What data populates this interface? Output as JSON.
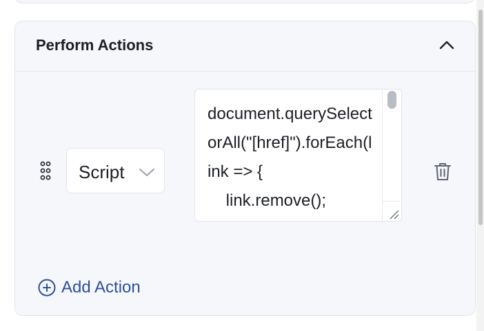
{
  "section": {
    "title": "Perform Actions"
  },
  "action_row": {
    "type_select": {
      "selected": "Script"
    },
    "script_editor": {
      "value": "document.querySelectorAll(\"[href]\").forEach(link => {\n    link.remove();\n});"
    }
  },
  "add_action": {
    "label": "Add Action"
  },
  "colors": {
    "accent": "#2c4f9e",
    "card_bg": "#f6f7fb",
    "border": "#e1e4ec",
    "text": "#1b1e24",
    "icon": "#5f6470"
  },
  "icons": {
    "collapse": "chevron-up-icon",
    "drag": "drag-handle-icon",
    "select": "chevron-down-icon",
    "delete": "trash-icon",
    "add": "plus-circle-icon"
  }
}
